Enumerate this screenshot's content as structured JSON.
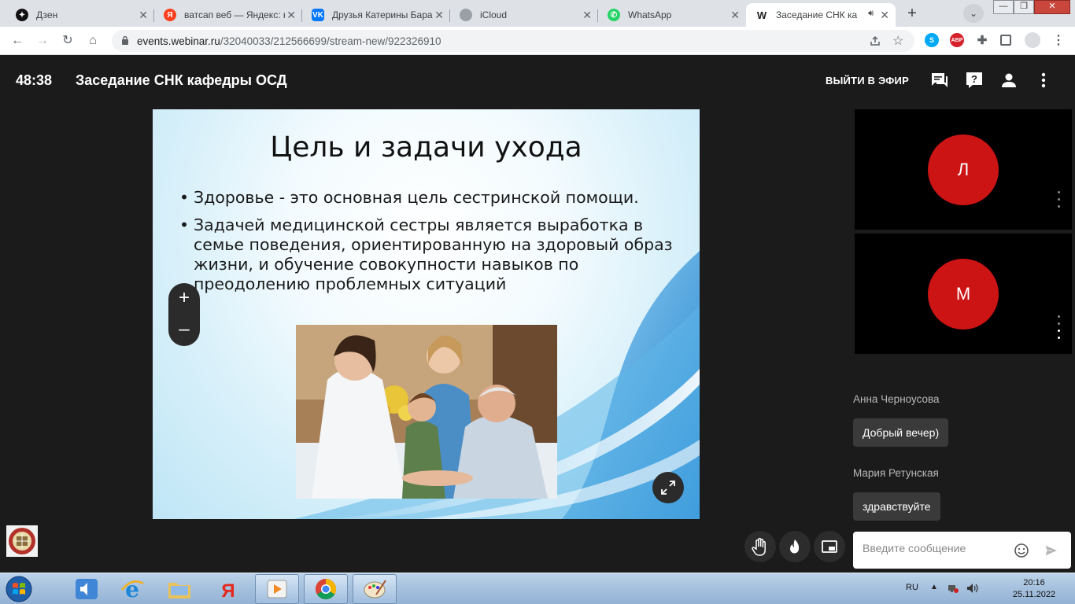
{
  "browser": {
    "tabs": [
      {
        "title": "Дзен",
        "icon": "zen-icon"
      },
      {
        "title": "ватсап веб — Яндекс: н",
        "icon": "yandex-icon"
      },
      {
        "title": "Друзья Катерины Бара",
        "icon": "vk-icon"
      },
      {
        "title": "iCloud",
        "icon": "apple-icon"
      },
      {
        "title": "WhatsApp",
        "icon": "whatsapp-icon"
      },
      {
        "title": "Заседание СНК ка",
        "icon": "webinar-icon",
        "active": true
      }
    ],
    "url_host": "events.webinar.ru",
    "url_path": "/32040033/212566699/stream-new/922326910"
  },
  "header": {
    "timer": "48:38",
    "title": "Заседание СНК кафедры ОСД",
    "go_live_label": "ВЫЙТИ В ЭФИР"
  },
  "slide": {
    "title": "Цель и задачи ухода",
    "bullets": [
      "Здоровье - это основная цель сестринской помощи.",
      "Задачей медицинской сестры является выработка в семье поведения, ориентированную на здоровый образ жизни, и обучение совокупности навыков по преодолению проблемных ситуаций"
    ]
  },
  "zoom": {
    "plus": "+",
    "minus": "–"
  },
  "participants": [
    {
      "initial": "Л",
      "color": "#cc1414"
    },
    {
      "initial": "М",
      "color": "#cc1414"
    }
  ],
  "chat": {
    "messages": [
      {
        "author": "Анна Черноусова",
        "text": "Добрый вечер)"
      },
      {
        "author": "Мария Ретунская",
        "text": "здравствуйте"
      }
    ],
    "input_placeholder": "Введите сообщение"
  },
  "taskbar": {
    "lang": "RU",
    "time": "20:16",
    "date": "25.11.2022"
  },
  "colors": {
    "accent_red": "#cc1414",
    "app_bg": "#1b1b1b",
    "chat_bubble": "#3a3a3a"
  }
}
